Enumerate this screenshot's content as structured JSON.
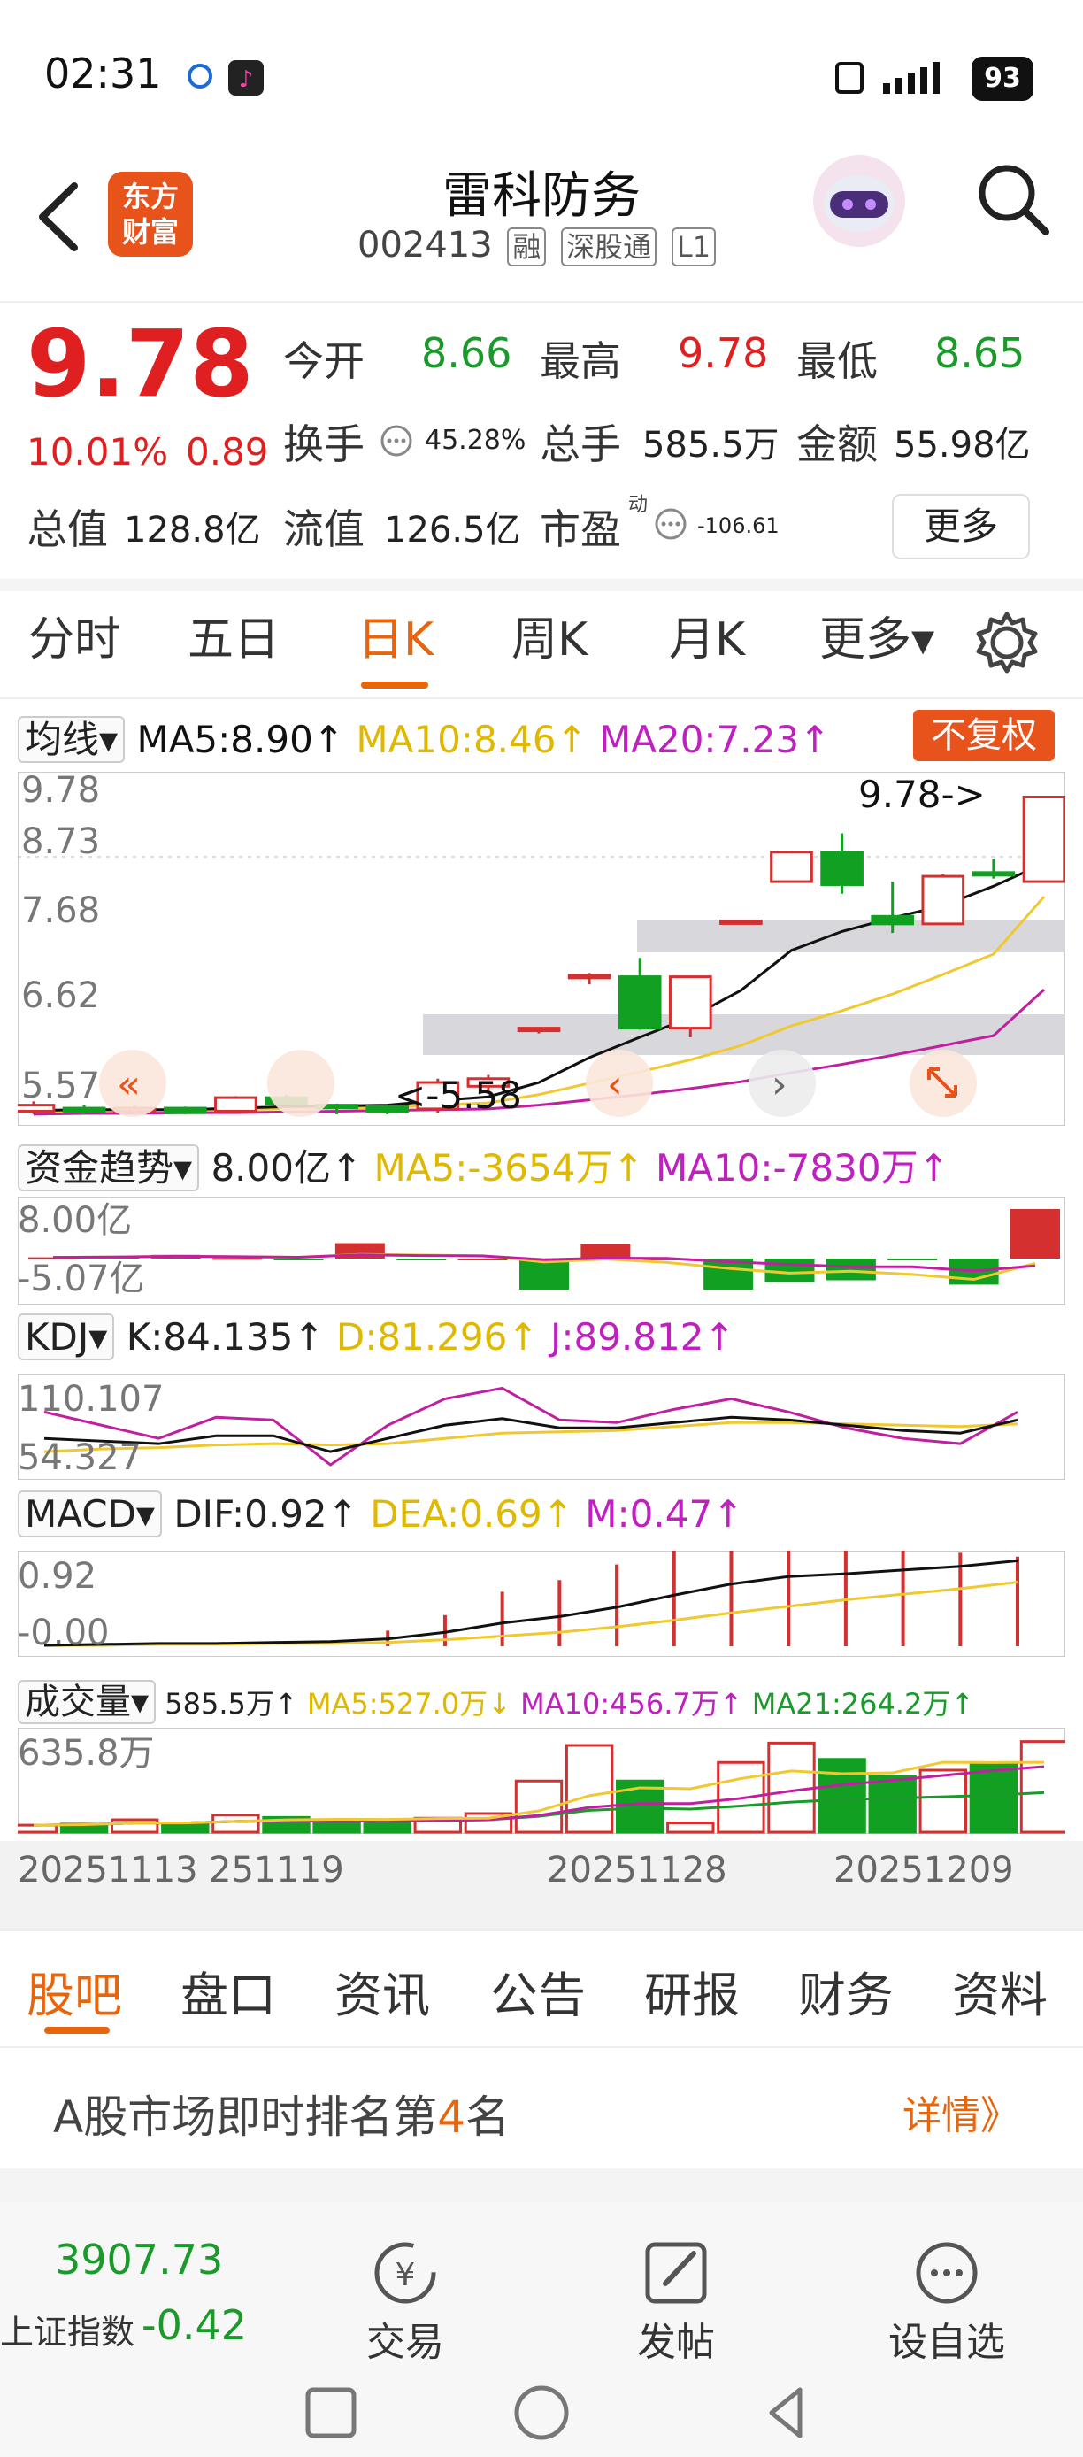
{
  "status_bar": {
    "time": "02:31",
    "battery": "93"
  },
  "header": {
    "logo_text_1": "东方",
    "logo_text_2": "财富",
    "stock_name": "雷科防务",
    "stock_code": "002413",
    "tags": [
      "融",
      "深股通",
      "L1"
    ]
  },
  "quote": {
    "price": "9.78",
    "change_pct": "10.01%",
    "change_amt": "0.89",
    "open_label": "今开",
    "open": "8.66",
    "high_label": "最高",
    "high": "9.78",
    "low_label": "最低",
    "low": "8.65",
    "turnover_label": "换手",
    "turnover": "45.28%",
    "volume_label": "总手",
    "volume": "585.5万",
    "amount_label": "金额",
    "amount": "55.98亿",
    "mktcap_label": "总值",
    "mktcap": "128.8亿",
    "float_label": "流值",
    "float_cap": "126.5亿",
    "pe_label": "市盈",
    "pe_sup": "动",
    "pe": "-106.61",
    "more": "更多"
  },
  "ktabs": [
    "分时",
    "五日",
    "日K",
    "周K",
    "月K",
    "更多▾"
  ],
  "ma_row": {
    "selector": "均线▾",
    "ma5": "MA5:8.90↑",
    "ma10": "MA10:8.46↑",
    "ma20": "MA20:7.23↑",
    "adjust": "不复权"
  },
  "price_axis": {
    "top": "9.78",
    "l2": "8.73",
    "l3": "7.68",
    "l4": "6.62",
    "bottom": "5.57"
  },
  "chart_annotations": {
    "high_marker": "9.78->",
    "low_marker": "<-5.58"
  },
  "capital_row": {
    "selector": "资金趋势▾",
    "value": "8.00亿↑",
    "ma5": "MA5:-3654万↑",
    "ma10": "MA10:-7830万↑"
  },
  "capital_axis": {
    "top": "8.00亿",
    "bottom": "-5.07亿"
  },
  "kdj_row": {
    "selector": "KDJ▾",
    "k": "K:84.135↑",
    "d": "D:81.296↑",
    "j": "J:89.812↑"
  },
  "kdj_axis": {
    "top": "110.107",
    "bottom": "54.327"
  },
  "macd_row": {
    "selector": "MACD▾",
    "dif": "DIF:0.92↑",
    "dea": "DEA:0.69↑",
    "m": "M:0.47↑"
  },
  "macd_axis": {
    "top": "0.92",
    "bottom": "-0.00"
  },
  "vol_row": {
    "selector": "成交量▾",
    "vol": "585.5万↑",
    "ma5": "MA5:527.0万↓",
    "ma10": "MA10:456.7万↑",
    "ma21": "MA21:264.2万↑"
  },
  "vol_axis": {
    "top": "635.8万"
  },
  "dates": [
    "20251113",
    "251119",
    "20251128",
    "20251209"
  ],
  "chart_data": {
    "type": "candlestick",
    "candles": [
      {
        "o": 5.62,
        "c": 5.7,
        "h": 5.75,
        "l": 5.58
      },
      {
        "o": 5.66,
        "c": 5.62,
        "h": 5.7,
        "l": 5.58
      },
      {
        "o": 5.62,
        "c": 5.66,
        "h": 5.7,
        "l": 5.6
      },
      {
        "o": 5.66,
        "c": 5.6,
        "h": 5.68,
        "l": 5.58
      },
      {
        "o": 5.62,
        "c": 5.8,
        "h": 5.82,
        "l": 5.6
      },
      {
        "o": 5.8,
        "c": 5.72,
        "h": 5.84,
        "l": 5.7
      },
      {
        "o": 5.7,
        "c": 5.68,
        "h": 5.72,
        "l": 5.58
      },
      {
        "o": 5.68,
        "c": 5.62,
        "h": 5.7,
        "l": 5.58
      },
      {
        "o": 5.65,
        "c": 6.0,
        "h": 6.05,
        "l": 5.6
      },
      {
        "o": 5.95,
        "c": 6.05,
        "h": 6.1,
        "l": 5.9
      },
      {
        "o": 6.7,
        "c": 6.72,
        "h": 6.72,
        "l": 6.65
      },
      {
        "o": 7.4,
        "c": 7.42,
        "h": 7.45,
        "l": 7.3
      },
      {
        "o": 7.4,
        "c": 6.72,
        "h": 7.65,
        "l": 6.7
      },
      {
        "o": 6.72,
        "c": 7.4,
        "h": 7.4,
        "l": 6.6
      },
      {
        "o": 8.12,
        "c": 8.14,
        "h": 8.14,
        "l": 8.1
      },
      {
        "o": 8.66,
        "c": 9.05,
        "h": 9.07,
        "l": 8.66
      },
      {
        "o": 9.05,
        "c": 8.62,
        "h": 9.3,
        "l": 8.5
      },
      {
        "o": 8.2,
        "c": 8.1,
        "h": 8.66,
        "l": 7.98
      },
      {
        "o": 8.1,
        "c": 8.73,
        "h": 8.76,
        "l": 8.1
      },
      {
        "o": 8.78,
        "c": 8.76,
        "h": 8.96,
        "l": 8.7
      },
      {
        "o": 8.66,
        "c": 9.78,
        "h": 9.78,
        "l": 8.65
      }
    ],
    "ma5": [
      5.63,
      5.64,
      5.64,
      5.64,
      5.66,
      5.68,
      5.69,
      5.7,
      5.76,
      5.81,
      6.0,
      6.33,
      6.6,
      6.86,
      7.22,
      7.75,
      8.0,
      8.18,
      8.34,
      8.6,
      8.9
    ],
    "ma10": [
      5.62,
      5.62,
      5.63,
      5.63,
      5.64,
      5.65,
      5.66,
      5.67,
      5.7,
      5.73,
      5.84,
      5.99,
      6.14,
      6.3,
      6.49,
      6.75,
      6.95,
      7.17,
      7.43,
      7.7,
      8.46
    ],
    "ma20": [
      5.58,
      5.59,
      5.59,
      5.6,
      5.6,
      5.61,
      5.62,
      5.63,
      5.64,
      5.65,
      5.7,
      5.77,
      5.84,
      5.92,
      6.01,
      6.13,
      6.24,
      6.36,
      6.49,
      6.62,
      7.23
    ],
    "volume": [
      45,
      52,
      80,
      60,
      110,
      95,
      70,
      75,
      90,
      120,
      330,
      560,
      330,
      60,
      450,
      575,
      470,
      360,
      400,
      440,
      585
    ],
    "capital": [
      0.2,
      0.3,
      0.6,
      0.1,
      -0.1,
      2.5,
      -0.2,
      0.0,
      -5.0,
      2.3,
      -0.2,
      -5.0,
      -3.8,
      -3.5,
      -0.3,
      -4.2,
      8.0
    ],
    "k": [
      70,
      68,
      66,
      72,
      72,
      60,
      70,
      80,
      85,
      78,
      78,
      82,
      86,
      84,
      80,
      76,
      74,
      84
    ],
    "d": [
      60,
      62,
      63,
      65,
      66,
      65,
      66,
      70,
      74,
      75,
      76,
      79,
      82,
      82,
      81,
      80,
      79,
      81
    ],
    "j": [
      90,
      80,
      70,
      86,
      84,
      50,
      80,
      100,
      108,
      84,
      82,
      92,
      100,
      90,
      78,
      70,
      66,
      90
    ],
    "dif": [
      0.01,
      0.02,
      0.03,
      0.03,
      0.04,
      0.05,
      0.08,
      0.15,
      0.25,
      0.32,
      0.42,
      0.55,
      0.67,
      0.75,
      0.78,
      0.82,
      0.86,
      0.92
    ],
    "dea": [
      0.01,
      0.01,
      0.02,
      0.02,
      0.03,
      0.03,
      0.04,
      0.07,
      0.11,
      0.15,
      0.21,
      0.28,
      0.36,
      0.43,
      0.5,
      0.56,
      0.62,
      0.69
    ],
    "colors": {
      "up": "#d43030",
      "down": "#11a021",
      "ma5": "#111111",
      "ma10": "#f0c830",
      "ma20": "#c020a0"
    }
  },
  "bottom_tabs": [
    "股吧",
    "盘口",
    "资讯",
    "公告",
    "研报",
    "财务",
    "资料"
  ],
  "rank": {
    "prefix": "A股市场即时排名第",
    "num": "4",
    "suffix": "名",
    "detail": "详情》"
  },
  "footer": {
    "index_value": "3907.73",
    "index_name": "上证指数",
    "index_change": "-0.42",
    "trade": "交易",
    "post": "发帖",
    "watch": "设自选"
  }
}
